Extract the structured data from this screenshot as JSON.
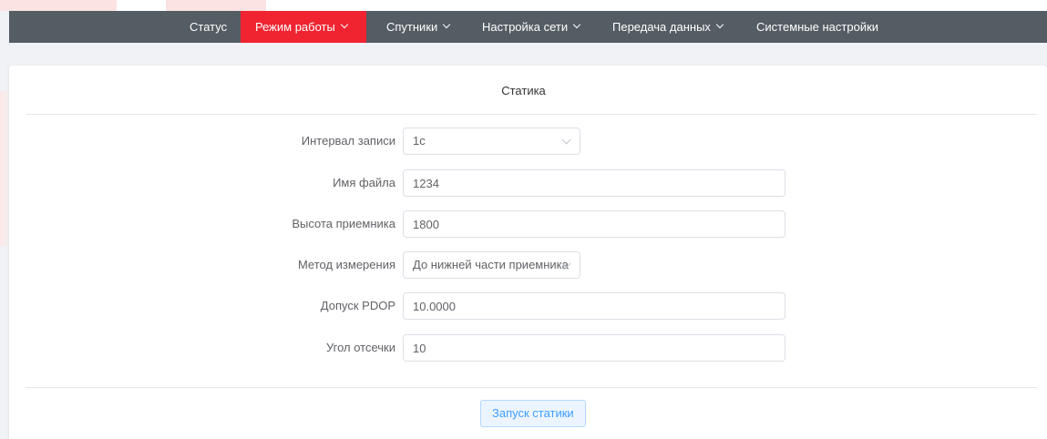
{
  "nav": {
    "items": [
      {
        "label": "Статус",
        "has_dropdown": false,
        "active": false
      },
      {
        "label": "Режим работы",
        "has_dropdown": true,
        "active": true
      },
      {
        "label": "Спутники",
        "has_dropdown": true,
        "active": false
      },
      {
        "label": "Настройка сети",
        "has_dropdown": true,
        "active": false
      },
      {
        "label": "Передача данных",
        "has_dropdown": true,
        "active": false
      },
      {
        "label": "Системные настройки",
        "has_dropdown": false,
        "active": false
      }
    ]
  },
  "card": {
    "title": "Статика"
  },
  "form": {
    "record_interval": {
      "label": "Интервал записи",
      "value": "1с"
    },
    "file_name": {
      "label": "Имя файла",
      "value": "1234"
    },
    "receiver_height": {
      "label": "Высота приемника",
      "value": "1800"
    },
    "measure_method": {
      "label": "Метод измерения",
      "value": "До нижней части приемника"
    },
    "pdop_tolerance": {
      "label": "Допуск PDOP",
      "value": "10.0000"
    },
    "cutoff_angle": {
      "label": "Угол отсечки",
      "value": "10"
    }
  },
  "actions": {
    "start_label": "Запуск статики"
  },
  "colors": {
    "nav_bg": "#545c64",
    "nav_active": "#f02431",
    "button_bg": "#ecf5ff",
    "button_text": "#409eff"
  }
}
